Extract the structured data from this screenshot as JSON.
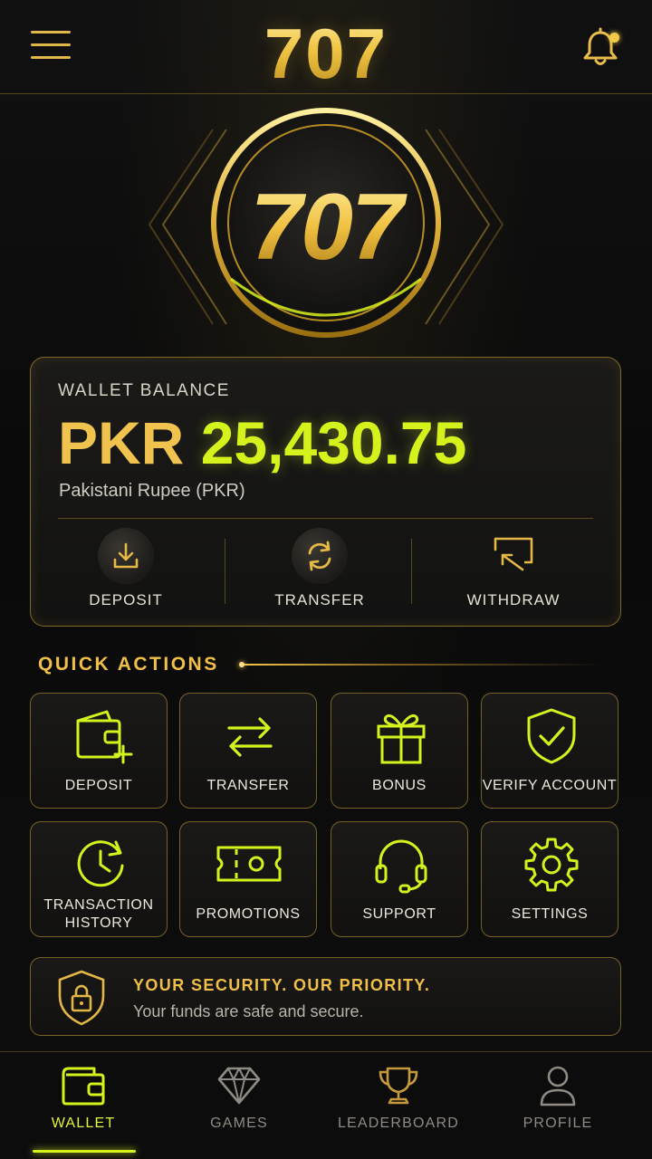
{
  "header": {
    "logo": "707",
    "menu_icon": "hamburger-menu-icon",
    "notification_icon": "bell-icon"
  },
  "emblem": {
    "text": "707"
  },
  "wallet": {
    "label": "WALLET BALANCE",
    "currency": "PKR",
    "amount": "25,430.75",
    "currency_name": "Pakistani Rupee (PKR)",
    "actions": [
      {
        "label": "DEPOSIT",
        "icon": "download-icon"
      },
      {
        "label": "TRANSFER",
        "icon": "refresh-icon"
      },
      {
        "label": "WITHDRAW",
        "icon": "withdraw-icon"
      }
    ]
  },
  "quick_actions": {
    "title": "QUICK ACTIONS",
    "items": [
      {
        "label": "DEPOSIT",
        "icon": "wallet-add-icon"
      },
      {
        "label": "TRANSFER",
        "icon": "swap-arrows-icon"
      },
      {
        "label": "BONUS",
        "icon": "gift-icon"
      },
      {
        "label": "VERIFY ACCOUNT",
        "icon": "shield-check-icon"
      },
      {
        "label": "TRANSACTION HISTORY",
        "line1": "TRANSACTION",
        "line2": "HISTORY",
        "icon": "history-clock-icon"
      },
      {
        "label": "PROMOTIONS",
        "icon": "ticket-icon"
      },
      {
        "label": "SUPPORT",
        "icon": "headset-icon"
      },
      {
        "label": "SETTINGS",
        "icon": "gear-icon"
      }
    ]
  },
  "security": {
    "title": "YOUR SECURITY. OUR PRIORITY.",
    "subtitle": "Your funds are safe and secure.",
    "icon": "shield-lock-icon"
  },
  "bottom_nav": {
    "items": [
      {
        "label": "WALLET",
        "icon": "wallet-icon",
        "active": true
      },
      {
        "label": "GAMES",
        "icon": "diamond-icon",
        "active": false
      },
      {
        "label": "LEADERBOARD",
        "icon": "trophy-icon",
        "active": false
      },
      {
        "label": "PROFILE",
        "icon": "user-icon",
        "active": false
      }
    ]
  },
  "colors": {
    "gold": "#f0c24e",
    "neon": "#d6f21d",
    "background": "#0b0b0b"
  }
}
